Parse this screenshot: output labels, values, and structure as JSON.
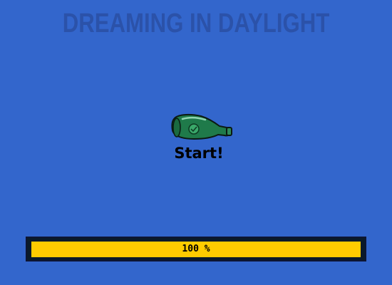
{
  "game": {
    "title": "DREAMING IN DAYLIGHT",
    "start_label": "Start!",
    "start_icon": "green-bottle-icon"
  },
  "loading": {
    "progress_percent": 100,
    "progress_text": "100 %",
    "fill_color": "#ffcc00"
  },
  "colors": {
    "background": "#3366cc",
    "title": "#2b52a9",
    "bottle": "#1f7a4a"
  }
}
